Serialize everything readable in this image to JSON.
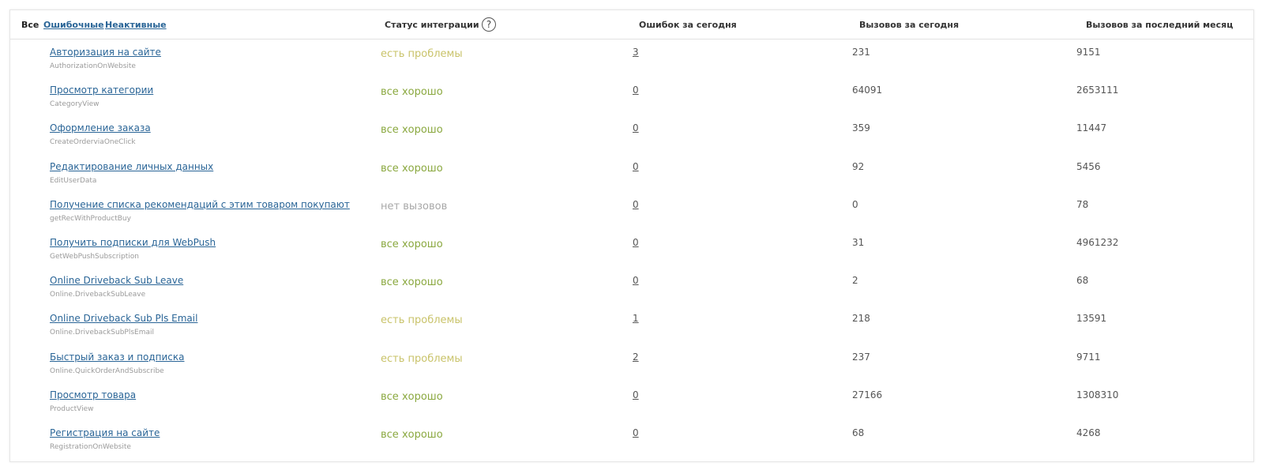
{
  "colors": {
    "ok": "#8aa83f",
    "problem": "#c9c36a",
    "no_calls": "#a8a8a8",
    "link": "#2a6597"
  },
  "filters": {
    "all": "Все",
    "errors": "Ошибочные",
    "inactive": "Неактивные"
  },
  "columns": {
    "status": "Статус интеграции",
    "status_help": "?",
    "errors_today": "Ошибок за сегодня",
    "calls_today": "Вызовов за сегодня",
    "calls_month": "Вызовов за последний месяц"
  },
  "rows": [
    {
      "name": "Авторизация на сайте",
      "code": "AuthorizationOnWebsite",
      "status": "есть проблемы",
      "status_type": "problem",
      "errors": "3",
      "calls_today": "231",
      "calls_month": "9151"
    },
    {
      "name": "Просмотр категории",
      "code": "CategoryView",
      "status": "все хорошо",
      "status_type": "ok",
      "errors": "0",
      "calls_today": "64091",
      "calls_month": "2653111"
    },
    {
      "name": "Оформление заказа",
      "code": "CreateOrderviaOneClick",
      "status": "все хорошо",
      "status_type": "ok",
      "errors": "0",
      "calls_today": "359",
      "calls_month": "11447"
    },
    {
      "name": "Редактирование личных данных",
      "code": "EditUserData",
      "status": "все хорошо",
      "status_type": "ok",
      "errors": "0",
      "calls_today": "92",
      "calls_month": "5456"
    },
    {
      "name": "Получение списка рекомендаций с этим товаром покупают",
      "code": "getRecWithProductBuy",
      "status": "нет вызовов",
      "status_type": "no_calls",
      "errors": "0",
      "calls_today": "0",
      "calls_month": "78"
    },
    {
      "name": "Получить подписки для WebPush",
      "code": "GetWebPushSubscription",
      "status": "все хорошо",
      "status_type": "ok",
      "errors": "0",
      "calls_today": "31",
      "calls_month": "4961232"
    },
    {
      "name": "Online Driveback Sub Leave",
      "code": "Online.DrivebackSubLeave",
      "status": "все хорошо",
      "status_type": "ok",
      "errors": "0",
      "calls_today": "2",
      "calls_month": "68"
    },
    {
      "name": "Online Driveback Sub Pls Email",
      "code": "Online.DrivebackSubPlsEmail",
      "status": "есть проблемы",
      "status_type": "problem",
      "errors": "1",
      "calls_today": "218",
      "calls_month": "13591"
    },
    {
      "name": "Быстрый заказ и подписка",
      "code": "Online.QuickOrderAndSubscribe",
      "status": "есть проблемы",
      "status_type": "problem",
      "errors": "2",
      "calls_today": "237",
      "calls_month": "9711"
    },
    {
      "name": "Просмотр товара",
      "code": "ProductView",
      "status": "все хорошо",
      "status_type": "ok",
      "errors": "0",
      "calls_today": "27166",
      "calls_month": "1308310"
    },
    {
      "name": "Регистрация на сайте",
      "code": "RegistrationOnWebsite",
      "status": "все хорошо",
      "status_type": "ok",
      "errors": "0",
      "calls_today": "68",
      "calls_month": "4268"
    }
  ]
}
